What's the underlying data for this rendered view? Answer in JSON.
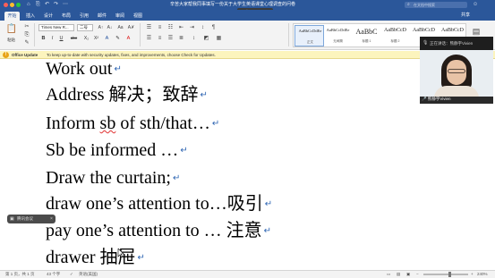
{
  "titlebar": {
    "doc_title": "辛苦大家帮我同事填写一份关于大学生英语课堂心理调查的问卷",
    "search_placeholder": "在文档中搜索",
    "search_icon": "⌕",
    "quick_access": [
      "⌂",
      "⎘",
      "↶",
      "↷",
      "⋯"
    ],
    "profile_icon": "☺",
    "share_banner": "腾讯会议"
  },
  "tabs": {
    "items": [
      "开始",
      "插入",
      "设计",
      "布局",
      "引用",
      "邮件",
      "审阅",
      "视图"
    ],
    "active": "开始",
    "share": "共享"
  },
  "ribbon": {
    "paste_label": "粘贴",
    "font_name": "Times New R...",
    "font_size": "二号",
    "grow_font": "A↑",
    "shrink_font": "A↓",
    "change_case": "Aa",
    "clear_format": "A✗",
    "bold": "B",
    "italic": "I",
    "underline": "U",
    "strikethrough": "abc",
    "subscript": "X₂",
    "superscript": "X²",
    "font_color": "A",
    "highlight": "✎",
    "bullets": "☰",
    "numbering": "≡",
    "indent_decrease": "⇤",
    "indent_increase": "⇥",
    "sort": "↕",
    "show_marks": "¶",
    "styles": [
      {
        "sample": "AaBbCcDdEe",
        "name": "正文",
        "size": "4.5px",
        "selected": true
      },
      {
        "sample": "AaBbCcDdEe",
        "name": "无间隔",
        "size": "4.5px",
        "selected": false
      },
      {
        "sample": "AaBbC",
        "name": "标题 1",
        "size": "8px",
        "selected": false
      },
      {
        "sample": "AaBbCcD",
        "name": "标题 2",
        "size": "6px",
        "selected": false
      },
      {
        "sample": "AaBbCcD",
        "name": "标题",
        "size": "6px",
        "selected": false
      },
      {
        "sample": "AaBbCcD",
        "name": "副标题",
        "size": "6px",
        "selected": false
      }
    ],
    "styles_pane_icon": "▤"
  },
  "update_bar": {
    "title": "Office Update",
    "message": "To keep up-to-date with security updates, fixes, and improvements, choose Check for Updates.",
    "close": "×"
  },
  "document": {
    "lines": [
      {
        "text": "Work out",
        "mark": "↵"
      },
      {
        "text": "Address  解决；致辞",
        "mark": "↵"
      },
      {
        "pre": "Inform ",
        "squiggle": "sb",
        "post": " of sth/that…",
        "mark": "↵"
      },
      {
        "text": "Sb be informed …",
        "mark": "↵"
      },
      {
        "text": "Draw the curtain;",
        "mark": "↵"
      },
      {
        "text": "draw one’s attention to…吸引",
        "mark": "↵"
      },
      {
        "text": "pay one’s attention to …  注意",
        "mark": "↵"
      },
      {
        "text": "drawer  抽屉",
        "mark": "↵"
      }
    ]
  },
  "video": {
    "speaking": "正在讲话：熊静宇Vivien",
    "name": "熊静宇Vivien"
  },
  "toast": {
    "text": "腾讯会议",
    "icon": "▣",
    "close": "×"
  },
  "statusbar": {
    "page": "第 1 页，共 1 页",
    "words": "43 个字",
    "language": "英语(美国)",
    "zoom": "240%",
    "zoom_level": 0.6
  }
}
